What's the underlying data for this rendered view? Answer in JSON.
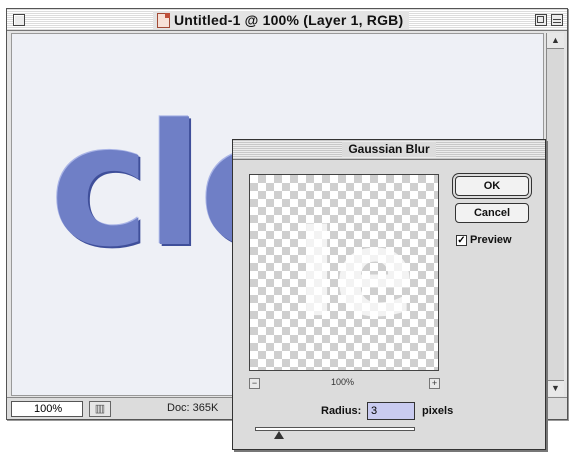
{
  "document_window": {
    "title": "Untitled-1 @ 100% (Layer 1, RGB)",
    "canvas_text": "cle",
    "zoom_field": "100%",
    "doc_info": "Doc: 365K"
  },
  "dialog": {
    "title": "Gaussian Blur",
    "preview_text": "le",
    "preview_zoom": "100%",
    "ok_label": "OK",
    "cancel_label": "Cancel",
    "preview_label": "Preview",
    "preview_checked": true,
    "radius_label": "Radius:",
    "radius_value": "3",
    "radius_unit": "pixels",
    "radius_slider_fraction": 0.15
  },
  "icons": {
    "close": "close-box-icon",
    "zoom": "zoom-box-icon",
    "collapse": "collapse-box-icon",
    "doc": "document-icon",
    "zoom_out": "minus-icon",
    "zoom_in": "plus-icon"
  },
  "colors": {
    "logo_fill": "#6f7fc6",
    "logo_shadow": "#3f4f9a",
    "radius_field_highlight": "#c9cbf0"
  }
}
